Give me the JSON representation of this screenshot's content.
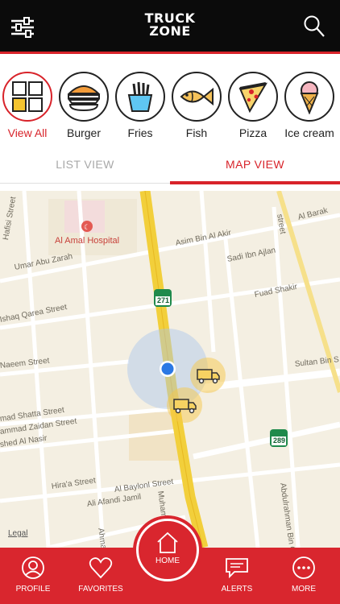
{
  "header": {
    "logo_line1": "TRUCK",
    "logo_line2": "ZONE",
    "filter_icon": "sliders-icon",
    "search_icon": "search-icon"
  },
  "categories": [
    {
      "label": "View All",
      "icon": "grid-icon",
      "active": true
    },
    {
      "label": "Burger",
      "icon": "burger-icon",
      "active": false
    },
    {
      "label": "Fries",
      "icon": "fries-icon",
      "active": false
    },
    {
      "label": "Fish",
      "icon": "fish-icon",
      "active": false
    },
    {
      "label": "Pizza",
      "icon": "pizza-icon",
      "active": false
    },
    {
      "label": "Ice cream",
      "icon": "ice-cream-icon",
      "active": false
    }
  ],
  "tabs": {
    "list": "LIST VIEW",
    "map": "MAP VIEW",
    "active": "map"
  },
  "map": {
    "poi": "Al Amal Hospital",
    "legal": "Legal",
    "route_shields": [
      "271",
      "289"
    ],
    "streets": [
      "Hafisi Street",
      "Umar Abu Zarah",
      "Asim Bin Al Akir",
      "Sadi Ibn Ajlan",
      "Fuad Shakir",
      "Al Barak",
      "street",
      "Ishaq Qarea Street",
      "Naeem Street",
      "Sultan Bin S",
      "mad Shatta Street",
      "ammad Zaidan Street",
      "shed Al Nasir",
      "Hira'a Street",
      "Al Baylonl Street",
      "Ali Afandi Jamil",
      "Muhammi",
      "Ahma",
      "Abdulrahman Bin G"
    ]
  },
  "bottom_nav": {
    "profile": "PROFILE",
    "favorites": "FAVORITES",
    "home": "HOME",
    "alerts": "ALERTS",
    "more": "MORE"
  },
  "colors": {
    "accent": "#d8232a",
    "header_bg": "#0b0b0b",
    "map_bg": "#f4efe2",
    "road_major": "#f2cf3b"
  }
}
